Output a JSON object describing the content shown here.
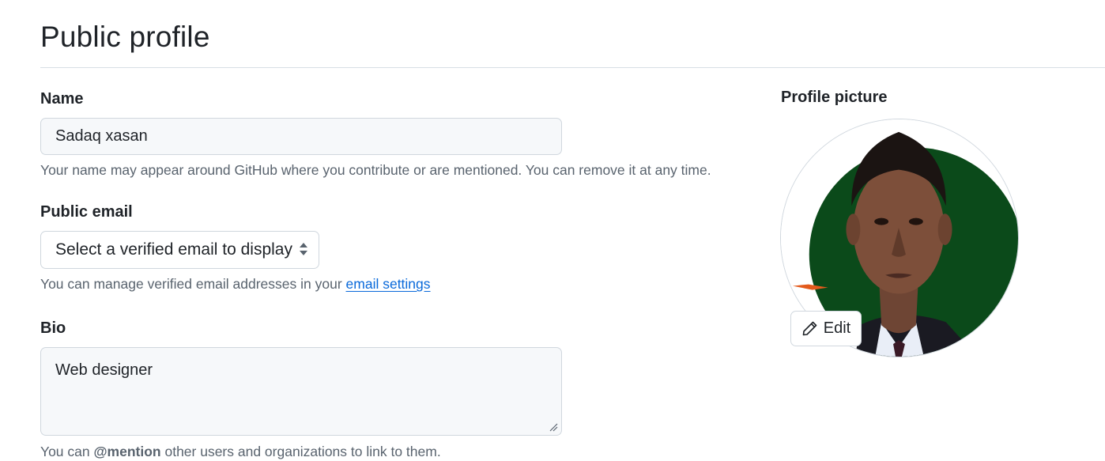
{
  "page": {
    "title": "Public profile"
  },
  "name_field": {
    "label": "Name",
    "value": "Sadaq xasan",
    "note": "Your name may appear around GitHub where you contribute or are mentioned. You can remove it at any time."
  },
  "email_field": {
    "label": "Public email",
    "selected": "Select a verified email to display",
    "note_prefix": "You can manage verified email addresses in your ",
    "note_link": "email settings"
  },
  "bio_field": {
    "label": "Bio",
    "value": "Web designer",
    "note_prefix": "You can ",
    "note_mention": "@mention",
    "note_suffix": " other users and organizations to link to them."
  },
  "profile_picture": {
    "label": "Profile picture",
    "edit_label": "Edit"
  },
  "colors": {
    "link": "#0969da",
    "avatar_background": "#0b4a1a",
    "input_background": "#f6f8fa",
    "border": "#d0d7de"
  },
  "icons": {
    "edit": "pencil-icon",
    "select": "select-caret-icon",
    "textarea": "resize-grip-icon"
  }
}
